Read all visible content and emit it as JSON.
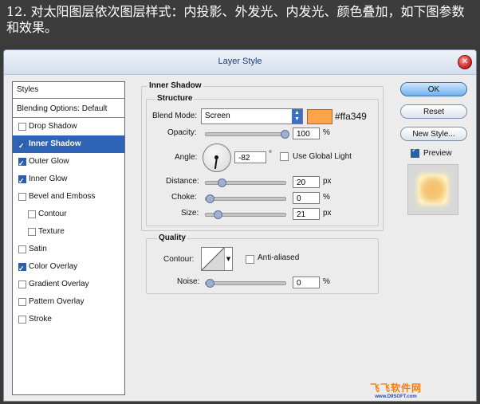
{
  "caption": "12. 对太阳图层依次图层样式：内投影、外发光、内发光、颜色叠加，如下图参数和效果。",
  "window": {
    "title": "Layer Style"
  },
  "sidebar": {
    "header": "Styles",
    "blending": "Blending Options: Default",
    "items": [
      {
        "label": "Drop Shadow",
        "checked": false
      },
      {
        "label": "Inner Shadow",
        "checked": true
      },
      {
        "label": "Outer Glow",
        "checked": true
      },
      {
        "label": "Inner Glow",
        "checked": true
      },
      {
        "label": "Bevel and Emboss",
        "checked": false
      },
      {
        "label": "Contour",
        "checked": false
      },
      {
        "label": "Texture",
        "checked": false
      },
      {
        "label": "Satin",
        "checked": false
      },
      {
        "label": "Color Overlay",
        "checked": true
      },
      {
        "label": "Gradient Overlay",
        "checked": false
      },
      {
        "label": "Pattern Overlay",
        "checked": false
      },
      {
        "label": "Stroke",
        "checked": false
      }
    ]
  },
  "inner_shadow": {
    "title": "Inner Shadow",
    "structure": {
      "title": "Structure",
      "blend_mode_label": "Blend Mode:",
      "blend_mode": "Screen",
      "color": "#ffa349",
      "color_hex_label": "#ffa349",
      "opacity_label": "Opacity:",
      "opacity": "100",
      "opacity_unit": "%",
      "angle_label": "Angle:",
      "angle": "-82",
      "angle_unit": "°",
      "global_light_label": "Use Global Light",
      "distance_label": "Distance:",
      "distance": "20",
      "distance_unit": "px",
      "choke_label": "Choke:",
      "choke": "0",
      "choke_unit": "%",
      "size_label": "Size:",
      "size": "21",
      "size_unit": "px"
    },
    "quality": {
      "title": "Quality",
      "contour_label": "Contour:",
      "anti_aliased_label": "Anti-aliased",
      "noise_label": "Noise:",
      "noise": "0",
      "noise_unit": "%"
    }
  },
  "buttons": {
    "ok": "OK",
    "reset": "Reset",
    "new_style": "New Style...",
    "preview": "Preview"
  },
  "watermark": {
    "line1": "飞飞软件网",
    "line2": "www.D9SOFT.com"
  },
  "slider_levels": {
    "opacity": 1.0,
    "distance": 0.15,
    "choke": 0.0,
    "size": 0.1,
    "noise": 0.0
  }
}
